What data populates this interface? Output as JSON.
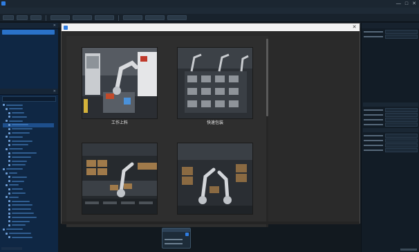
{
  "window": {
    "title": "",
    "controls": [
      "—",
      "□",
      "✕"
    ]
  },
  "menubar": {
    "items": [
      "",
      "",
      "",
      "",
      "",
      "",
      "",
      ""
    ]
  },
  "left_panel_top": {
    "title": "",
    "selected_item": ""
  },
  "left_panel_bottom": {
    "title": "",
    "tree_items": [
      "",
      "",
      "",
      "",
      "",
      "",
      "",
      "",
      "",
      "",
      "",
      "",
      "",
      "",
      "",
      "",
      "",
      "",
      "",
      "",
      "",
      "",
      "",
      "",
      "",
      "",
      "",
      "",
      "",
      "",
      "",
      "",
      "",
      ""
    ]
  },
  "dialog": {
    "title": "",
    "close_glyph": "✕",
    "scenes": [
      {
        "label": "工作上料",
        "icon": "robot-arm-loading"
      },
      {
        "label": "快速包装",
        "icon": "fast-packaging"
      },
      {
        "label": "",
        "icon": "palletizing-line"
      },
      {
        "label": "",
        "icon": "stacking-robots"
      }
    ],
    "description": [
      "",
      "",
      "",
      "",
      "",
      "",
      "",
      "",
      "",
      "",
      ""
    ]
  },
  "colors": {
    "accent": "#2f7de1",
    "panel_bg": "#0f2744",
    "dialog_bg": "#2a2a2a",
    "dialog_title_bg": "#f2f2f2",
    "selection": "#2a72c9"
  }
}
